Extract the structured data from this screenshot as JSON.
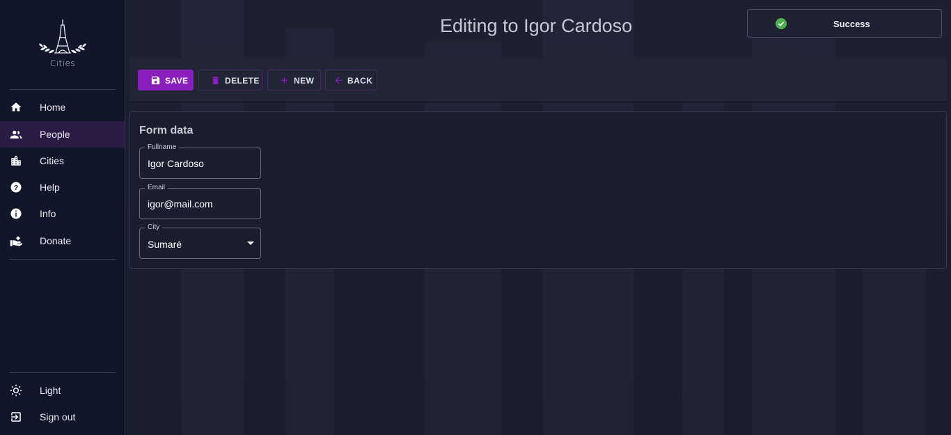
{
  "sidebar": {
    "logo_text": "Cities",
    "nav": [
      {
        "label": "Home",
        "icon": "home-icon"
      },
      {
        "label": "People",
        "icon": "people-icon",
        "active": true
      },
      {
        "label": "Cities",
        "icon": "city-icon"
      },
      {
        "label": "Help",
        "icon": "help-icon"
      },
      {
        "label": "Info",
        "icon": "info-icon"
      },
      {
        "label": "Donate",
        "icon": "donate-icon"
      }
    ],
    "bottom": [
      {
        "label": "Light",
        "icon": "sun-icon"
      },
      {
        "label": "Sign out",
        "icon": "logout-icon"
      }
    ]
  },
  "header": {
    "title": "Editing to Igor Cardoso"
  },
  "toast": {
    "text": "Success",
    "icon": "check-circle-icon",
    "color": "#4caf50"
  },
  "toolbar": {
    "save_label": "SAVE",
    "delete_label": "DELETE",
    "new_label": "NEW",
    "back_label": "BACK"
  },
  "form": {
    "title": "Form data",
    "fullname": {
      "label": "Fullname",
      "value": "Igor Cardoso"
    },
    "email": {
      "label": "Email",
      "value": "igor@mail.com"
    },
    "city": {
      "label": "City",
      "value": "Sumaré"
    }
  },
  "colors": {
    "accent": "#8a1fbe",
    "sidebar_bg": "#12162a",
    "active_nav_bg": "#2b1c45"
  }
}
